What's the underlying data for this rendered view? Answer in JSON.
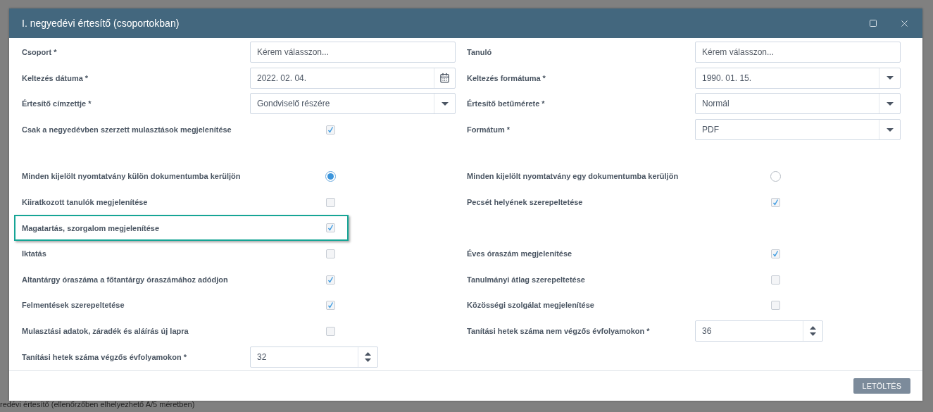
{
  "background": {
    "footer_text": "redévi értesítő (ellenőrzőben elhelyezhető A/5 méretben)"
  },
  "dialog": {
    "title": "I. negyedévi értesítő (csoportokban)",
    "sections": [
      {
        "rows": [
          {
            "left": {
              "kind": "input",
              "label": "Csoport *",
              "placeholder": "Kérem válasszon..."
            },
            "right": {
              "kind": "input",
              "label": "Tanuló",
              "placeholder": "Kérem válasszon..."
            }
          },
          {
            "left": {
              "kind": "date",
              "label": "Keltezés dátuma *",
              "value": "2022. 02. 04."
            },
            "right": {
              "kind": "select",
              "label": "Keltezés formátuma *",
              "value": "1990. 01. 15."
            }
          },
          {
            "left": {
              "kind": "select",
              "label": "Értesítő címzettje *",
              "value": "Gondviselő részére"
            },
            "right": {
              "kind": "select",
              "label": "Értesítő betűmérete *",
              "value": "Normál"
            }
          },
          {
            "left": {
              "kind": "checkbox",
              "label": "Csak a negyedévben szerzett mulasztások megjelenítése",
              "checked": true
            },
            "right": {
              "kind": "select",
              "label": "Formátum *",
              "value": "PDF"
            }
          }
        ]
      },
      {
        "rows": [
          {
            "left": {
              "kind": "radio",
              "label": "Minden kijelölt nyomtatvány külön dokumentumba kerüljön",
              "selected": true
            },
            "right": {
              "kind": "radio",
              "label": "Minden kijelölt nyomtatvány egy dokumentumba kerüljön",
              "selected": false
            }
          },
          {
            "left": {
              "kind": "checkbox",
              "label": "Kiiratkozott tanulók megjelenítése",
              "checked": false
            },
            "right": {
              "kind": "checkbox",
              "label": "Pecsét helyének szerepeltetése",
              "checked": true
            }
          },
          {
            "left": {
              "kind": "checkbox",
              "label": "Magatartás, szorgalom megjelenítése",
              "checked": true,
              "highlighted": true
            }
          },
          {
            "left": {
              "kind": "checkbox",
              "label": "Iktatás",
              "checked": false
            },
            "right": {
              "kind": "checkbox",
              "label": "Éves óraszám megjelenítése",
              "checked": true
            }
          },
          {
            "left": {
              "kind": "checkbox",
              "label": "Altantárgy óraszáma a főtantárgy óraszámához adódjon",
              "checked": true
            },
            "right": {
              "kind": "checkbox",
              "label": "Tanulmányi átlag szerepeltetése",
              "checked": false
            }
          },
          {
            "left": {
              "kind": "checkbox",
              "label": "Felmentések szerepeltetése",
              "checked": true
            },
            "right": {
              "kind": "checkbox",
              "label": "Közösségi szolgálat megjelenítése",
              "checked": false
            }
          },
          {
            "left": {
              "kind": "checkbox",
              "label": "Mulasztási adatok, záradék és aláírás új lapra",
              "checked": false
            },
            "right": {
              "kind": "number",
              "label": "Tanítási hetek száma nem végzős évfolyamokon *",
              "value": "36"
            }
          },
          {
            "left": {
              "kind": "number",
              "label": "Tanítási hetek száma végzős évfolyamokon *",
              "value": "32"
            }
          }
        ]
      }
    ],
    "button": "LETÖLTÉS"
  }
}
